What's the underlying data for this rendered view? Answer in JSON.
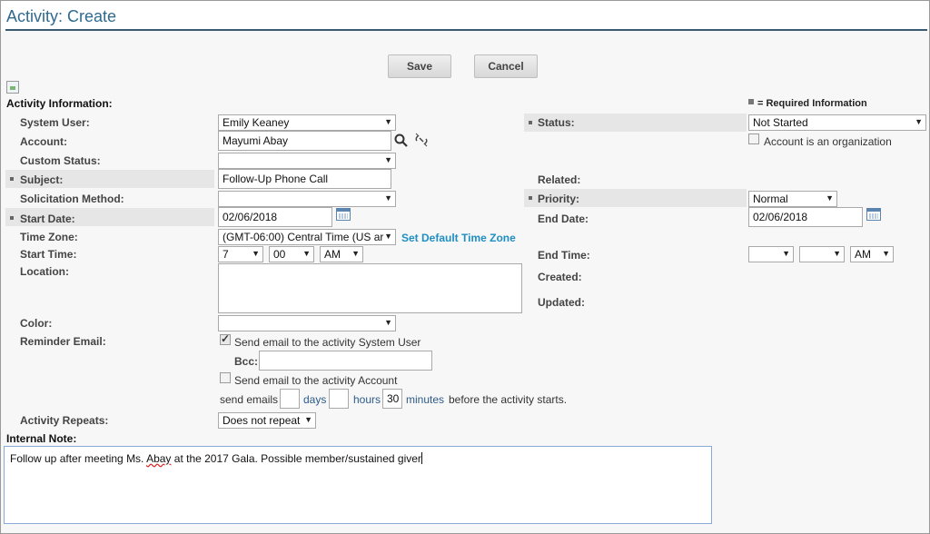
{
  "page": {
    "title": "Activity: Create"
  },
  "toolbar": {
    "save_label": "Save",
    "cancel_label": "Cancel"
  },
  "section": {
    "title": "Activity Information:",
    "required_info": "= Required Information"
  },
  "fields": {
    "system_user": {
      "label": "System User:",
      "value": "Emily Keaney"
    },
    "account": {
      "label": "Account:",
      "value": "Mayumi Abay"
    },
    "custom_status": {
      "label": "Custom Status:",
      "value": ""
    },
    "subject": {
      "label": "Subject:",
      "value": "Follow-Up Phone Call"
    },
    "solicitation_method": {
      "label": "Solicitation Method:",
      "value": ""
    },
    "start_date": {
      "label": "Start Date:",
      "value": "02/06/2018"
    },
    "time_zone": {
      "label": "Time Zone:",
      "value": "(GMT-06:00) Central Time (US ar",
      "link": "Set Default Time Zone"
    },
    "start_time": {
      "label": "Start Time:",
      "hour": "7",
      "minute": "00",
      "ampm": "AM"
    },
    "location": {
      "label": "Location:"
    },
    "color": {
      "label": "Color:",
      "value": ""
    },
    "reminder_email": {
      "label": "Reminder Email:",
      "send_system_user": "Send email to the activity System User",
      "bcc_label": "Bcc:",
      "send_account": "Send email to the activity Account",
      "send_emails": "send emails",
      "days_label": "days",
      "hours_label": "hours",
      "minutes_value": "30",
      "minutes_label": "minutes",
      "before_text": "before the activity starts."
    },
    "activity_repeats": {
      "label": "Activity Repeats:",
      "value": "Does not repeat"
    },
    "status": {
      "label": "Status:",
      "value": "Not Started"
    },
    "account_is_org": {
      "label": "Account is an organization"
    },
    "related": {
      "label": "Related:"
    },
    "priority": {
      "label": "Priority:",
      "value": "Normal"
    },
    "end_date": {
      "label": "End Date:",
      "value": "02/06/2018"
    },
    "end_time": {
      "label": "End Time:",
      "hour": "",
      "minute": "",
      "ampm": "AM"
    },
    "created": {
      "label": "Created:"
    },
    "updated": {
      "label": "Updated:"
    }
  },
  "internal_note": {
    "label": "Internal Note:",
    "text_before": "Follow up after meeting Ms. ",
    "text_misspelled": "Abay",
    "text_after": " at the 2017 Gala. Possible member/sustained giver"
  },
  "icons": {
    "search": "search-icon",
    "unlink": "unlink-icon",
    "calendar": "calendar-icon",
    "dropdown": "chevron-down-icon"
  }
}
